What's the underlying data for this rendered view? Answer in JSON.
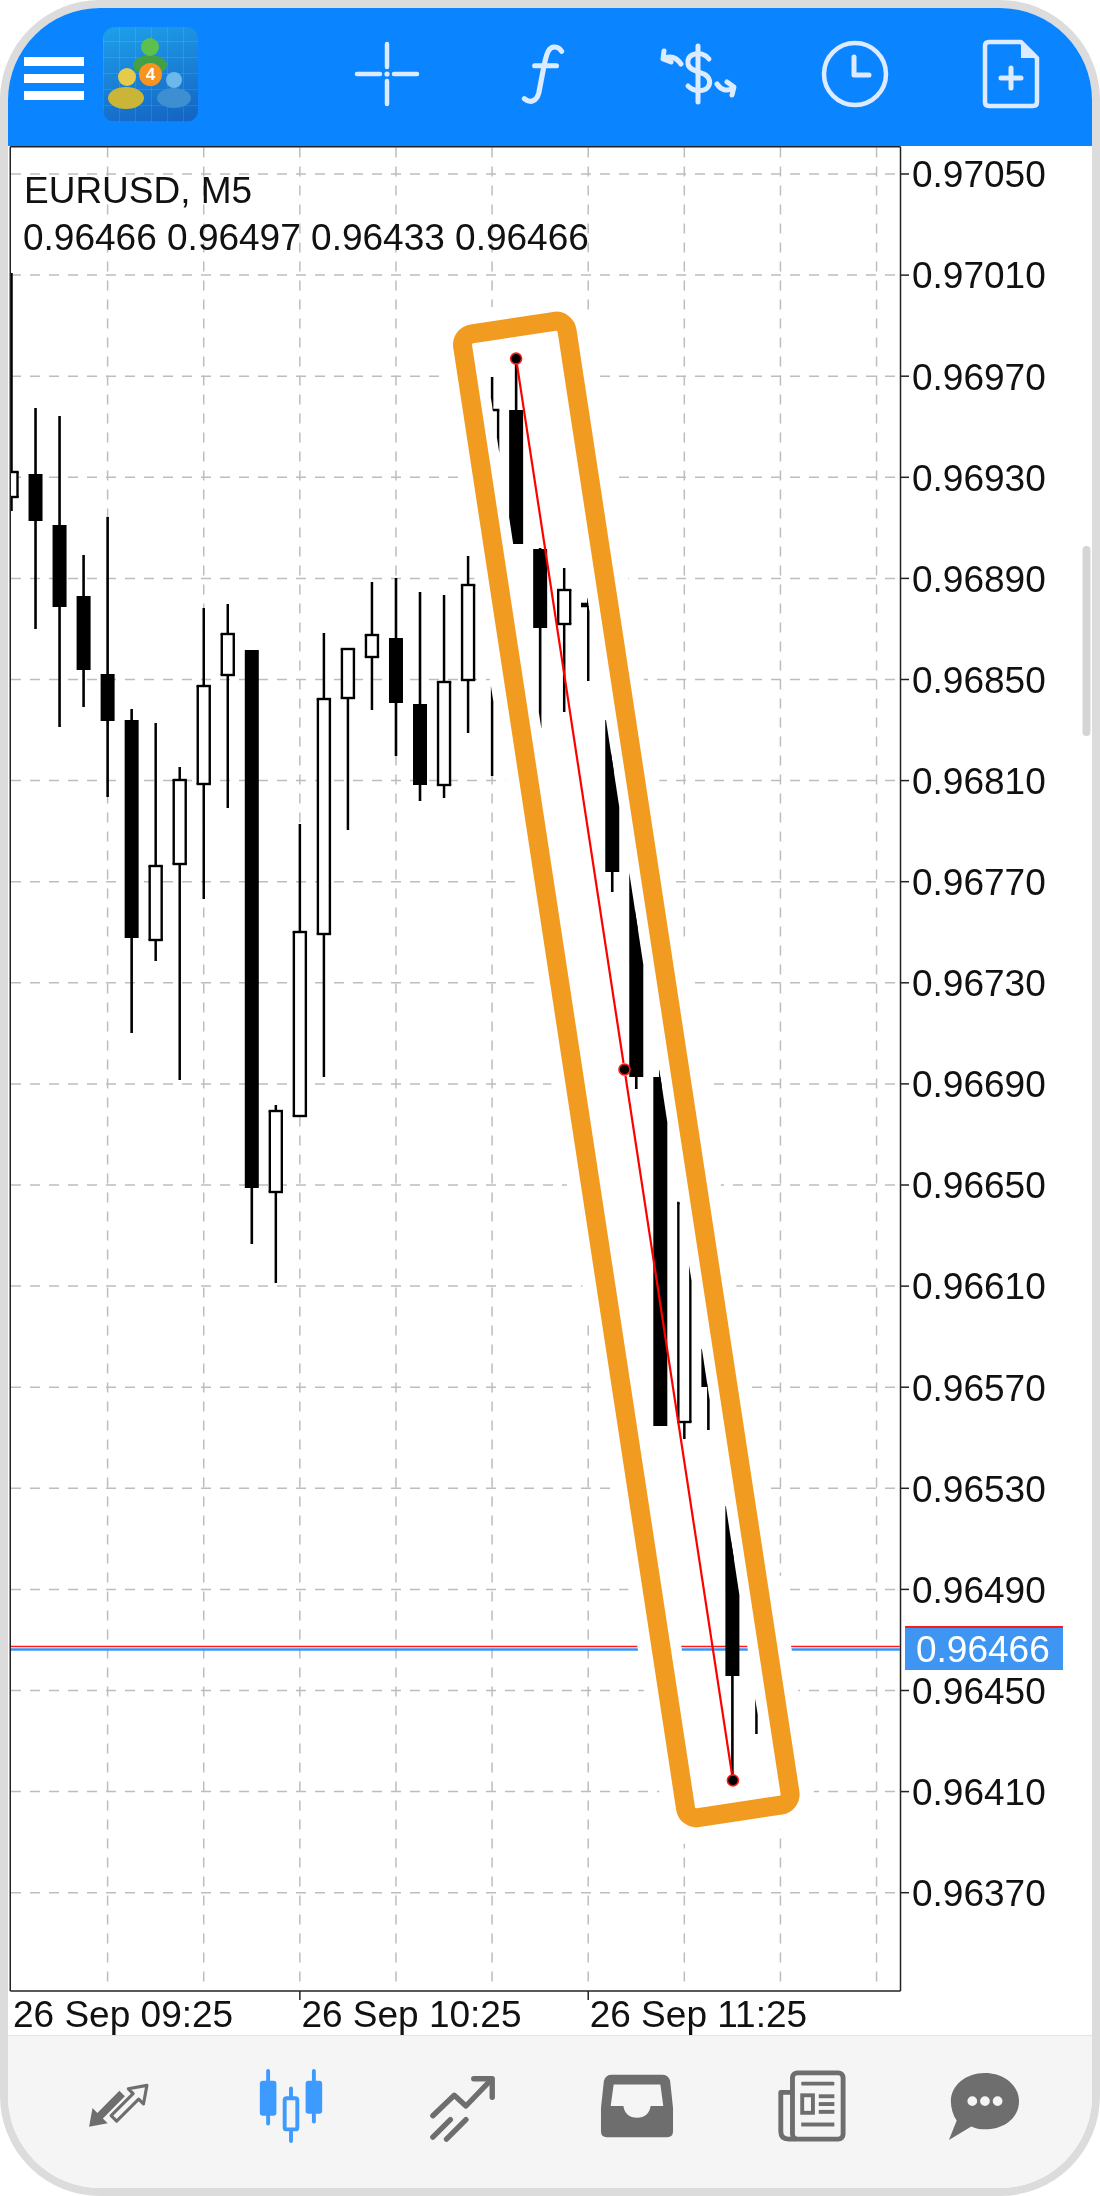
{
  "header": {
    "logo_badge": "4"
  },
  "chart": {
    "symbol": "EURUSD, M5",
    "ohlc": "0.96466 0.96497 0.96433 0.96466",
    "price_axis": [
      "0.97050",
      "0.97010",
      "0.96970",
      "0.96930",
      "0.96890",
      "0.96850",
      "0.96810",
      "0.96770",
      "0.96730",
      "0.96690",
      "0.96650",
      "0.96610",
      "0.96570",
      "0.96530",
      "0.96490",
      "0.96450",
      "0.96410",
      "0.96370"
    ],
    "current_price": "0.96466",
    "time_axis": [
      "26 Sep 09:25",
      "26 Sep 10:25",
      "26 Sep 11:25"
    ]
  },
  "bottom_nav": [
    {
      "selected": false
    },
    {
      "selected": true
    },
    {
      "selected": false
    },
    {
      "selected": false
    },
    {
      "selected": false
    },
    {
      "selected": false
    }
  ]
}
